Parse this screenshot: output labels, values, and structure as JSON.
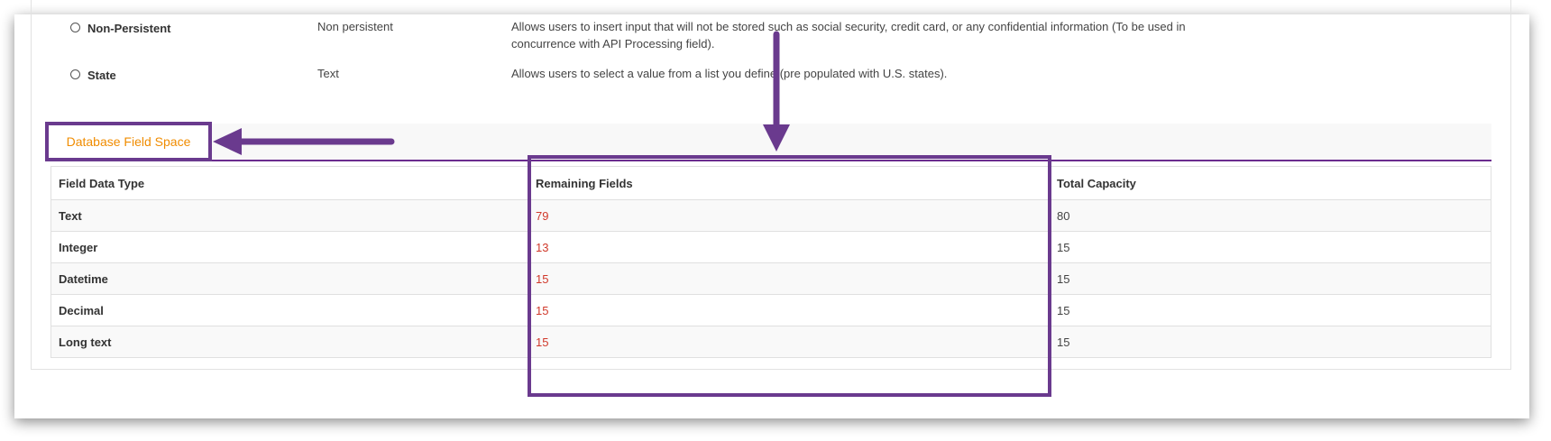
{
  "field_types": [
    {
      "name": "Non-Persistent",
      "data_type": "Non persistent",
      "description_line1": "Allows users to insert input that will not be stored such as social security, credit card, or any confidential information (To be used in",
      "description_line2": "concurrence with API Processing field)."
    },
    {
      "name": "State",
      "data_type": "Text",
      "description_line1": "Allows users to select a value from a list you define (pre populated with U.S. states).",
      "description_line2": ""
    }
  ],
  "section": {
    "title": "Database Field Space"
  },
  "table": {
    "headers": [
      "Field Data Type",
      "Remaining Fields",
      "Total Capacity"
    ],
    "rows": [
      {
        "type": "Text",
        "remaining": "79",
        "capacity": "80"
      },
      {
        "type": "Integer",
        "remaining": "13",
        "capacity": "15"
      },
      {
        "type": "Datetime",
        "remaining": "15",
        "capacity": "15"
      },
      {
        "type": "Decimal",
        "remaining": "15",
        "capacity": "15"
      },
      {
        "type": "Long text",
        "remaining": "15",
        "capacity": "15"
      }
    ]
  },
  "colors": {
    "accent_purple": "#6a3a8e",
    "tab_title_orange": "#f08c00",
    "remaining_red": "#d0392b"
  }
}
